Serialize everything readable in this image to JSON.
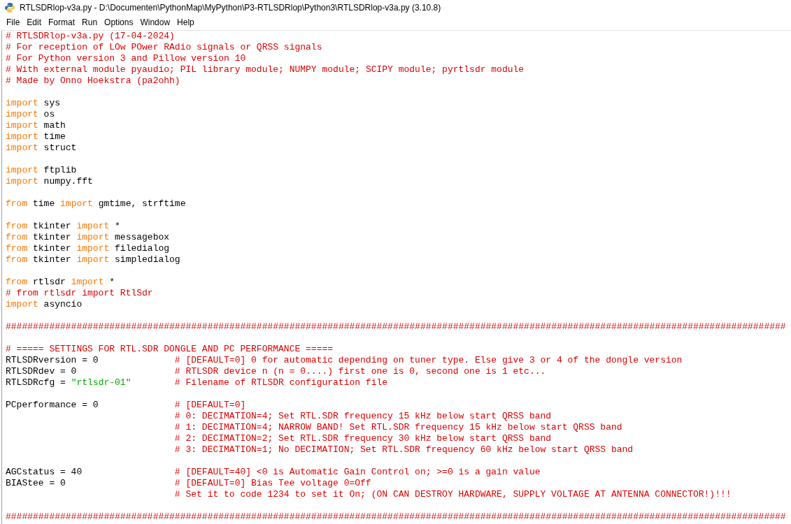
{
  "window": {
    "title": "RTLSDRlop-v3a.py - D:\\Documenten\\PythonMap\\MyPython\\P3-RTLSDRlop\\Python3\\RTLSDRlop-v3a.py (3.10.8)"
  },
  "menu": [
    "File",
    "Edit",
    "Format",
    "Run",
    "Options",
    "Window",
    "Help"
  ],
  "editor": {
    "lines": [
      {
        "kind": "code",
        "tokens": [
          {
            "kind": "comment",
            "text": "# RTLSDRlop-v3a.py (17-04-2024)"
          }
        ]
      },
      {
        "kind": "code",
        "tokens": [
          {
            "kind": "comment",
            "text": "# For reception of LOw POwer RAdio signals or QRSS signals"
          }
        ]
      },
      {
        "kind": "code",
        "tokens": [
          {
            "kind": "comment",
            "text": "# For Python version 3 and Pillow version 10"
          }
        ]
      },
      {
        "kind": "code",
        "tokens": [
          {
            "kind": "comment",
            "text": "# With external module pyaudio; PIL library module; NUMPY module; SCIPY module; pyrtlsdr module"
          }
        ]
      },
      {
        "kind": "code",
        "tokens": [
          {
            "kind": "comment",
            "text": "# Made by Onno Hoekstra (pa2ohh)"
          }
        ]
      },
      {
        "kind": "blank"
      },
      {
        "kind": "code",
        "tokens": [
          {
            "kind": "keyword",
            "text": "import"
          },
          {
            "kind": "plain",
            "text": " sys"
          }
        ]
      },
      {
        "kind": "code",
        "tokens": [
          {
            "kind": "keyword",
            "text": "import"
          },
          {
            "kind": "plain",
            "text": " os"
          }
        ]
      },
      {
        "kind": "code",
        "tokens": [
          {
            "kind": "keyword",
            "text": "import"
          },
          {
            "kind": "plain",
            "text": " math"
          }
        ]
      },
      {
        "kind": "code",
        "tokens": [
          {
            "kind": "keyword",
            "text": "import"
          },
          {
            "kind": "plain",
            "text": " time"
          }
        ]
      },
      {
        "kind": "code",
        "tokens": [
          {
            "kind": "keyword",
            "text": "import"
          },
          {
            "kind": "plain",
            "text": " struct"
          }
        ]
      },
      {
        "kind": "blank"
      },
      {
        "kind": "code",
        "tokens": [
          {
            "kind": "keyword",
            "text": "import"
          },
          {
            "kind": "plain",
            "text": " ftplib"
          }
        ]
      },
      {
        "kind": "code",
        "tokens": [
          {
            "kind": "keyword",
            "text": "import"
          },
          {
            "kind": "plain",
            "text": " numpy.fft"
          }
        ]
      },
      {
        "kind": "blank"
      },
      {
        "kind": "code",
        "tokens": [
          {
            "kind": "keyword",
            "text": "from"
          },
          {
            "kind": "plain",
            "text": " time "
          },
          {
            "kind": "keyword",
            "text": "import"
          },
          {
            "kind": "plain",
            "text": " gmtime, strftime"
          }
        ]
      },
      {
        "kind": "blank"
      },
      {
        "kind": "code",
        "tokens": [
          {
            "kind": "keyword",
            "text": "from"
          },
          {
            "kind": "plain",
            "text": " tkinter "
          },
          {
            "kind": "keyword",
            "text": "import"
          },
          {
            "kind": "plain",
            "text": " *"
          }
        ]
      },
      {
        "kind": "code",
        "tokens": [
          {
            "kind": "keyword",
            "text": "from"
          },
          {
            "kind": "plain",
            "text": " tkinter "
          },
          {
            "kind": "keyword",
            "text": "import"
          },
          {
            "kind": "plain",
            "text": " messagebox"
          }
        ]
      },
      {
        "kind": "code",
        "tokens": [
          {
            "kind": "keyword",
            "text": "from"
          },
          {
            "kind": "plain",
            "text": " tkinter "
          },
          {
            "kind": "keyword",
            "text": "import"
          },
          {
            "kind": "plain",
            "text": " filedialog"
          }
        ]
      },
      {
        "kind": "code",
        "tokens": [
          {
            "kind": "keyword",
            "text": "from"
          },
          {
            "kind": "plain",
            "text": " tkinter "
          },
          {
            "kind": "keyword",
            "text": "import"
          },
          {
            "kind": "plain",
            "text": " simpledialog"
          }
        ]
      },
      {
        "kind": "blank"
      },
      {
        "kind": "code",
        "tokens": [
          {
            "kind": "keyword",
            "text": "from"
          },
          {
            "kind": "plain",
            "text": " rtlsdr "
          },
          {
            "kind": "keyword",
            "text": "import"
          },
          {
            "kind": "plain",
            "text": " *"
          }
        ]
      },
      {
        "kind": "code",
        "tokens": [
          {
            "kind": "comment",
            "text": "# from rtlsdr import RtlSdr"
          }
        ]
      },
      {
        "kind": "code",
        "tokens": [
          {
            "kind": "keyword",
            "text": "import"
          },
          {
            "kind": "plain",
            "text": " asyncio"
          }
        ]
      },
      {
        "kind": "blank"
      },
      {
        "kind": "code",
        "tokens": [
          {
            "kind": "comment",
            "text": "###############################################################################################################################################"
          }
        ]
      },
      {
        "kind": "blank"
      },
      {
        "kind": "code",
        "tokens": [
          {
            "kind": "comment",
            "text": "# ===== SETTINGS FOR RTL.SDR DONGLE AND PC PERFORMANCE ====="
          }
        ]
      },
      {
        "kind": "annotated",
        "tokens": [
          {
            "kind": "plain",
            "text": "RTLSDRversion = 0"
          }
        ],
        "comment": "# [DEFAULT=0] 0 for automatic depending on tuner type. Else give 3 or 4 of the dongle version"
      },
      {
        "kind": "annotated",
        "tokens": [
          {
            "kind": "plain",
            "text": "RTLSDRdev = 0"
          }
        ],
        "comment": "# RTLSDR device n (n = 0....) first one is 0, second one is 1 etc..."
      },
      {
        "kind": "annotated",
        "tokens": [
          {
            "kind": "plain",
            "text": "RTLSDRcfg = "
          },
          {
            "kind": "string",
            "text": "\"rtlsdr-01\""
          }
        ],
        "comment": "# Filename of RTLSDR configuration file"
      },
      {
        "kind": "blank"
      },
      {
        "kind": "annotated",
        "tokens": [
          {
            "kind": "plain",
            "text": "PCperformance = 0"
          }
        ],
        "comment": "# [DEFAULT=0]"
      },
      {
        "kind": "annotated",
        "comment": "# 0: DECIMATION=4; Set RTL.SDR frequency 15 kHz below start QRSS band"
      },
      {
        "kind": "annotated",
        "comment": "# 1: DECIMATION=4; NARROW BAND! Set RTL.SDR frequency 15 kHz below start QRSS band"
      },
      {
        "kind": "annotated",
        "comment": "# 2: DECIMATION=2; Set RTL.SDR frequency 30 kHz below start QRSS band"
      },
      {
        "kind": "annotated",
        "comment": "# 3: DECIMATION=1; No DECIMATION; Set RTL.SDR frequency 60 kHz below start QRSS band"
      },
      {
        "kind": "blank"
      },
      {
        "kind": "annotated",
        "tokens": [
          {
            "kind": "plain",
            "text": "AGCstatus = 40"
          }
        ],
        "comment": "# [DEFAULT=40] <0 is Automatic Gain Control on; >=0 is a gain value"
      },
      {
        "kind": "annotated",
        "tokens": [
          {
            "kind": "plain",
            "text": "BIAStee = 0"
          }
        ],
        "comment": "# [DEFAULT=0] Bias Tee voltage 0=Off"
      },
      {
        "kind": "annotated",
        "comment": "# Set it to code 1234 to set it On; (ON CAN DESTROY HARDWARE, SUPPLY VOLTAGE AT ANTENNA CONNECTOR!)!!!"
      },
      {
        "kind": "blank"
      },
      {
        "kind": "code",
        "tokens": [
          {
            "kind": "comment",
            "text": "###############################################################################################################################################"
          }
        ]
      }
    ]
  }
}
